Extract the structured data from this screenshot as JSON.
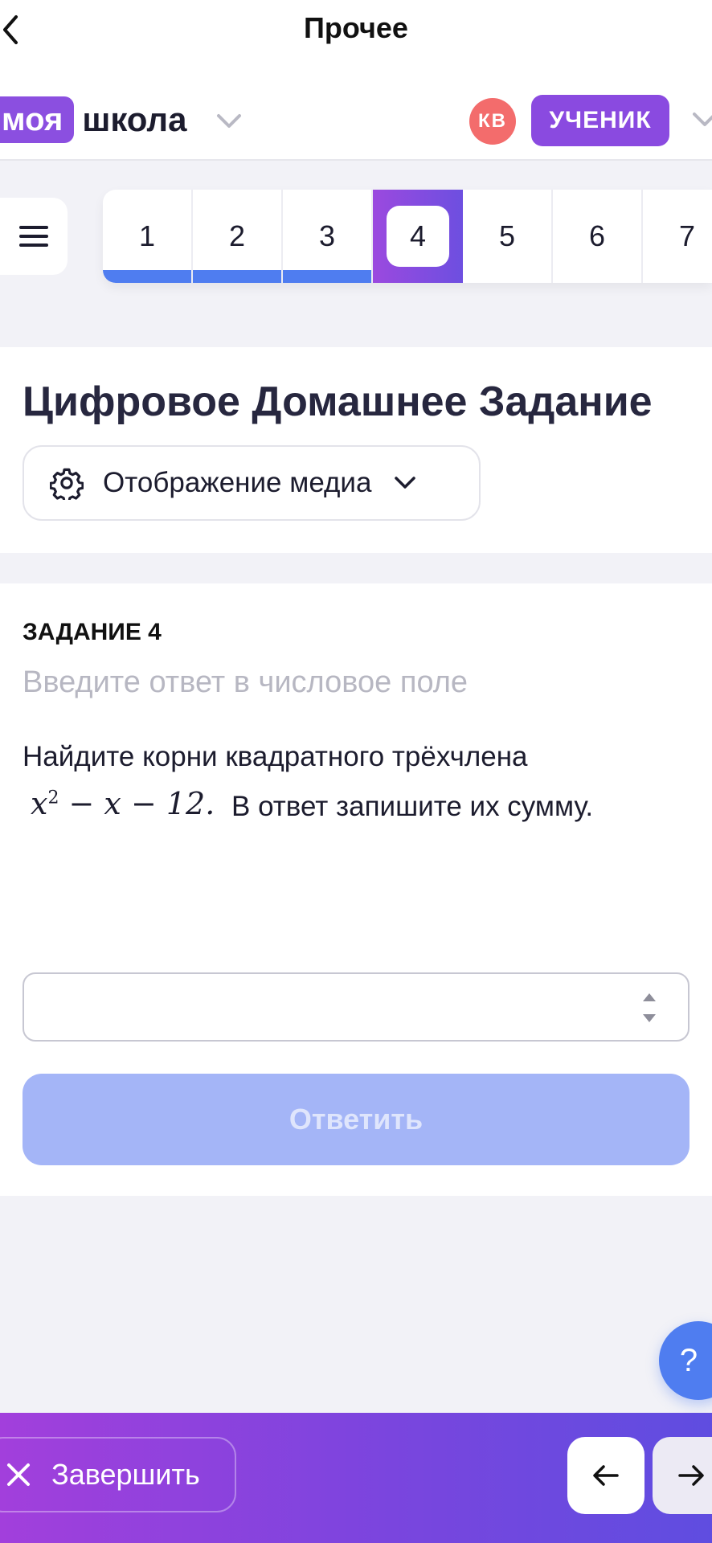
{
  "header": {
    "title": "Прочее",
    "brand_part1": "моя",
    "brand_part2": "школа",
    "avatar_initials": "КВ",
    "role": "УЧЕНИК"
  },
  "tasks": {
    "items": [
      "1",
      "2",
      "3",
      "4",
      "5",
      "6",
      "7"
    ],
    "active": "4",
    "completed": [
      "1",
      "2",
      "3"
    ]
  },
  "assignment": {
    "title": "Цифровое Домашнее Задание",
    "media_button": "Отображение медиа"
  },
  "task": {
    "label": "ЗАДАНИЕ 4",
    "hint": "Введите ответ в числовое поле",
    "text_line1": "Найдите корни квадратного трёхчлена",
    "math_var": "x",
    "math_exp": "2",
    "math_rest": " − x − 12.",
    "text_line2": "В ответ запишите их сумму.",
    "answer_value": "",
    "submit_label": "Ответить"
  },
  "help": {
    "label": "?"
  },
  "footer": {
    "finish_label": "Завершить"
  },
  "colors": {
    "accent_purple": "#8a4ae0",
    "progress_blue": "#4f7df0",
    "submit_disabled": "#a4b5f7",
    "avatar": "#f36c6c"
  },
  "icons": {
    "back": "chevron-left-icon",
    "menu": "hamburger-icon",
    "media": "gear-icon",
    "finish": "close-icon",
    "prev": "arrow-left-icon",
    "next": "arrow-right-icon"
  }
}
